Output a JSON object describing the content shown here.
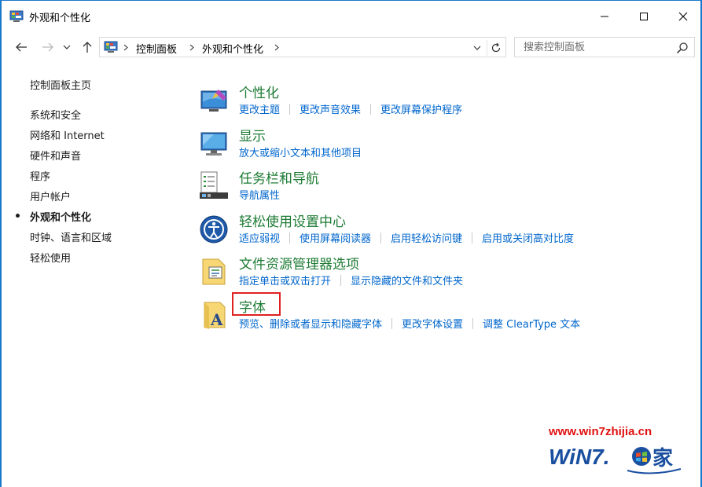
{
  "window": {
    "title": "外观和个性化"
  },
  "address": {
    "crumbs": [
      "控制面板",
      "外观和个性化"
    ],
    "search_placeholder": "搜索控制面板"
  },
  "leftnav": {
    "home": "控制面板主页",
    "items": [
      "系统和安全",
      "网络和 Internet",
      "硬件和声音",
      "程序",
      "用户帐户",
      "外观和个性化",
      "时钟、语言和区域",
      "轻松使用"
    ],
    "active_index": 5
  },
  "categories": [
    {
      "title": "个性化",
      "icon": "personalization-icon",
      "links": [
        "更改主题",
        "更改声音效果",
        "更改屏幕保护程序"
      ]
    },
    {
      "title": "显示",
      "icon": "display-icon",
      "links": [
        "放大或缩小文本和其他项目"
      ]
    },
    {
      "title": "任务栏和导航",
      "icon": "taskbar-icon",
      "links": [
        "导航属性"
      ]
    },
    {
      "title": "轻松使用设置中心",
      "icon": "ease-of-access-icon",
      "links": [
        "适应弱视",
        "使用屏幕阅读器",
        "启用轻松访问键",
        "启用或关闭高对比度"
      ]
    },
    {
      "title": "文件资源管理器选项",
      "icon": "folder-options-icon",
      "links": [
        "指定单击或双击打开",
        "显示隐藏的文件和文件夹"
      ]
    },
    {
      "title": "字体",
      "icon": "fonts-icon",
      "links": [
        "预览、删除或者显示和隐藏字体",
        "更改字体设置",
        "调整 ClearType 文本"
      ]
    }
  ],
  "watermark": {
    "url": "www.win7zhijia.cn"
  },
  "colors": {
    "accent": "#1979ca",
    "category_title": "#1e7b34",
    "link": "#0066cc",
    "highlight": "#e02020",
    "watermark_red": "#e01010",
    "watermark_blue": "#1a4fa0"
  }
}
